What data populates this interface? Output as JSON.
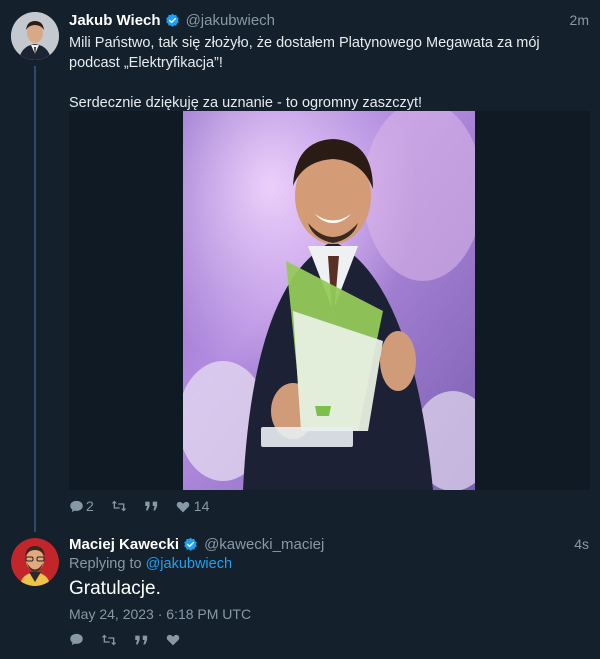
{
  "tweet1": {
    "author_name": "Jakub Wiech",
    "author_handle": "@jakubwiech",
    "time": "2m",
    "text_line1": "Mili Państwo, tak się złożyło, że dostałem Platynowego Megawata za mój",
    "text_line2": "podcast „Elektryfikacja”!",
    "text_line3": "Serdecznie dziękuję za uznanie - to ogromny zaszczyt!",
    "reply_count": "2",
    "retweet_count": "",
    "quote_count": "",
    "like_count": "14"
  },
  "tweet2": {
    "author_name": "Maciej Kawecki",
    "author_handle": "@kawecki_maciej",
    "time": "4s",
    "replying_prefix": "Replying to",
    "replying_handle": "@jakubwiech",
    "text": "Gratulacje.",
    "date": "May 24, 2023 · 6:18 PM UTC"
  },
  "colors": {
    "background": "#14202c",
    "accent": "#1da1f2",
    "muted": "#8899a6",
    "thread_line": "#2f4a6a"
  },
  "icons": [
    "verified-badge-icon",
    "reply-icon",
    "retweet-icon",
    "quote-icon",
    "like-icon"
  ]
}
